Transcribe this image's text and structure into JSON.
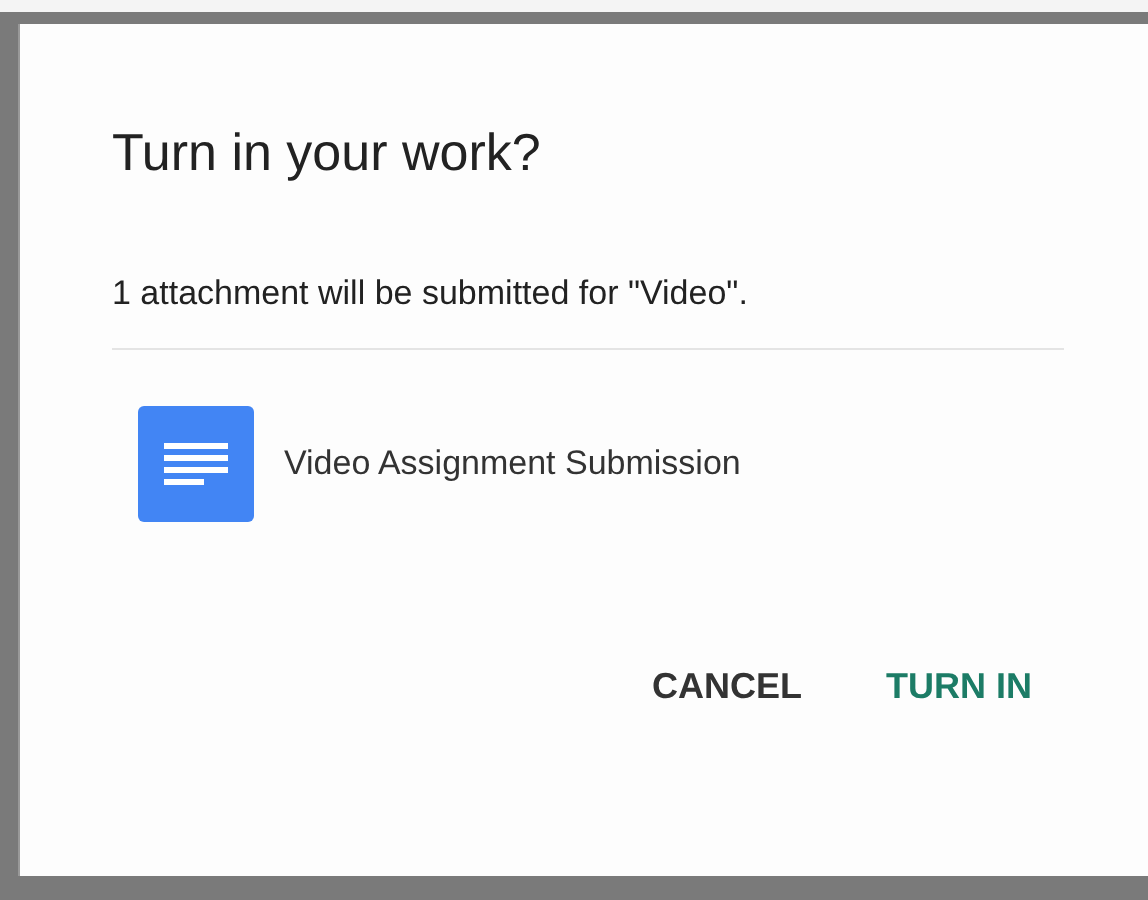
{
  "dialog": {
    "title": "Turn in your work?",
    "message": "1 attachment will be submitted for \"Video\".",
    "attachments": [
      {
        "kind": "document",
        "name": "Video Assignment Submission"
      }
    ],
    "buttons": [
      {
        "label": "CANCEL",
        "primary": false
      },
      {
        "label": "TURN IN",
        "primary": true
      }
    ]
  }
}
